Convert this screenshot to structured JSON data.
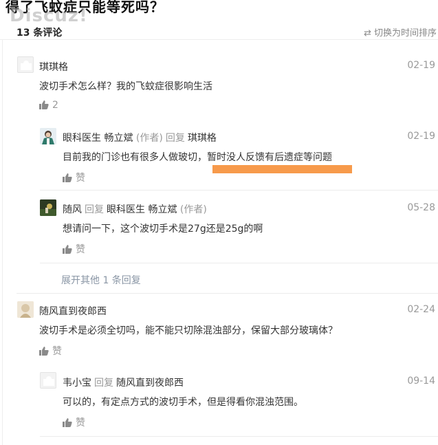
{
  "page": {
    "title": "得了飞蚊症只能等死吗？",
    "watermark": "Discuz!"
  },
  "header": {
    "count_label": "13 条评论",
    "sort_label": "切换为时间排序"
  },
  "comments": [
    {
      "name": "琪琪格",
      "date": "02-19",
      "text": "波切手术怎么样？我的飞蚊症很影响生活",
      "likes": "2"
    },
    {
      "role": "眼科医生",
      "name": "畅立斌",
      "author_tag": "(作者)",
      "reply_word": "回复",
      "reply_to": "琪琪格",
      "date": "02-19",
      "text": "目前我的门诊也有很多人做玻切，暂时没人反馈有后遗症等问题",
      "like_label": "赞"
    },
    {
      "name": "随风",
      "reply_word": "回复",
      "reply_to_role": "眼科医生",
      "reply_to": "畅立斌",
      "reply_to_tag": "(作者)",
      "date": "05-28",
      "text": "想请问一下，这个波切手术是27g还是25g的啊",
      "like_label": "赞"
    },
    {
      "expand_label": "展开其他 1 条回复"
    },
    {
      "name": "随风直到夜郎西",
      "date": "02-24",
      "text": "波切手术是必须全切吗，能不能只切除混浊部分，保留大部分玻璃体？",
      "like_label": "赞"
    },
    {
      "name": "韦小宝",
      "reply_word": "回复",
      "reply_to": "随风直到夜郎西",
      "date": "09-14",
      "text": "可以的，有定点方式的波切手术，但是得看你混浊范围。",
      "like_label": "赞"
    }
  ],
  "colors": {
    "highlight": "#f79a4b",
    "muted": "#999999",
    "text": "#333333"
  }
}
